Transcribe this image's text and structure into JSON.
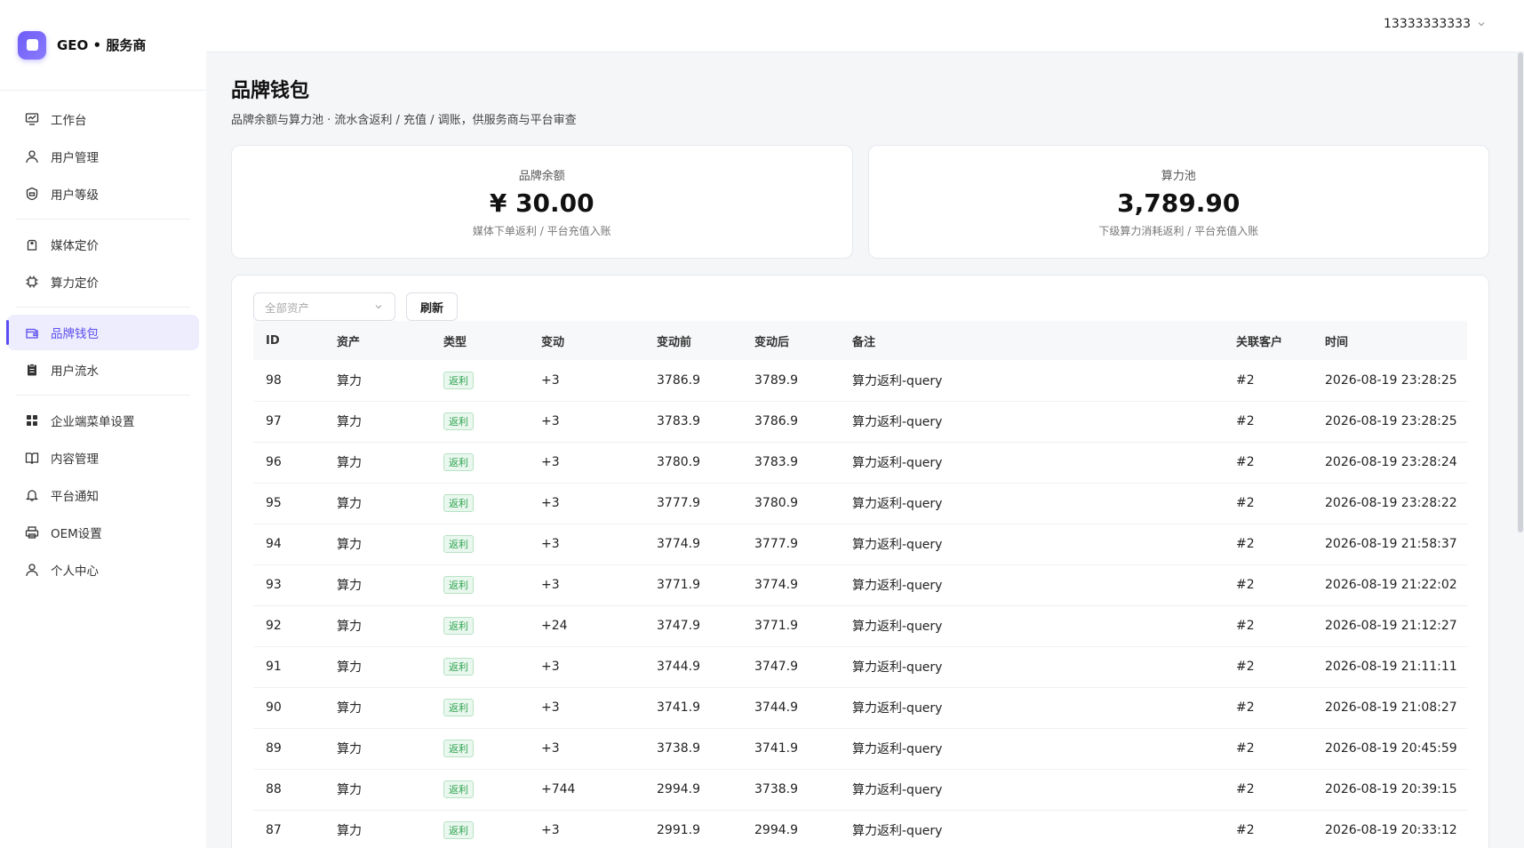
{
  "sidebar": {
    "brand": "GEO • 服务商",
    "items": [
      {
        "label": "工作台",
        "icon": "dashboard-icon"
      },
      {
        "label": "用户管理",
        "icon": "user-icon"
      },
      {
        "label": "用户等级",
        "icon": "badge-icon"
      },
      {
        "label": "媒体定价",
        "icon": "price-tag-icon"
      },
      {
        "label": "算力定价",
        "icon": "chip-icon"
      },
      {
        "label": "品牌钱包",
        "icon": "wallet-icon"
      },
      {
        "label": "用户流水",
        "icon": "clipboard-icon"
      },
      {
        "label": "企业端菜单设置",
        "icon": "grid-icon"
      },
      {
        "label": "内容管理",
        "icon": "book-icon"
      },
      {
        "label": "平台通知",
        "icon": "bell-icon"
      },
      {
        "label": "OEM设置",
        "icon": "printer-icon"
      },
      {
        "label": "个人中心",
        "icon": "person-icon"
      }
    ],
    "active": "品牌钱包"
  },
  "header": {
    "user": "13333333333"
  },
  "main": {
    "title": "品牌钱包",
    "subtitle": "品牌余额与算力池 · 流水含返利 / 充值 / 调账，供服务商与平台审查",
    "cards": [
      {
        "label": "品牌余额",
        "value": "¥ 30.00",
        "note": "媒体下单返利 / 平台充值入账"
      },
      {
        "label": "算力池",
        "value": "3,789.90",
        "note": "下级算力消耗返利 / 平台充值入账"
      }
    ],
    "filter": {
      "placeholder": "全部资产",
      "refresh": "刷新"
    },
    "table": {
      "columns": [
        "ID",
        "资产",
        "类型",
        "变动",
        "变动前",
        "变动后",
        "备注",
        "关联客户",
        "时间"
      ],
      "rows": [
        [
          "98",
          "算力",
          "返利",
          "+3",
          "3786.9",
          "3789.9",
          "算力返利-query",
          "#2",
          "2026-08-19 23:28:25"
        ],
        [
          "97",
          "算力",
          "返利",
          "+3",
          "3783.9",
          "3786.9",
          "算力返利-query",
          "#2",
          "2026-08-19 23:28:25"
        ],
        [
          "96",
          "算力",
          "返利",
          "+3",
          "3780.9",
          "3783.9",
          "算力返利-query",
          "#2",
          "2026-08-19 23:28:24"
        ],
        [
          "95",
          "算力",
          "返利",
          "+3",
          "3777.9",
          "3780.9",
          "算力返利-query",
          "#2",
          "2026-08-19 23:28:22"
        ],
        [
          "94",
          "算力",
          "返利",
          "+3",
          "3774.9",
          "3777.9",
          "算力返利-query",
          "#2",
          "2026-08-19 21:58:37"
        ],
        [
          "93",
          "算力",
          "返利",
          "+3",
          "3771.9",
          "3774.9",
          "算力返利-query",
          "#2",
          "2026-08-19 21:22:02"
        ],
        [
          "92",
          "算力",
          "返利",
          "+24",
          "3747.9",
          "3771.9",
          "算力返利-query",
          "#2",
          "2026-08-19 21:12:27"
        ],
        [
          "91",
          "算力",
          "返利",
          "+3",
          "3744.9",
          "3747.9",
          "算力返利-query",
          "#2",
          "2026-08-19 21:11:11"
        ],
        [
          "90",
          "算力",
          "返利",
          "+3",
          "3741.9",
          "3744.9",
          "算力返利-query",
          "#2",
          "2026-08-19 21:08:27"
        ],
        [
          "89",
          "算力",
          "返利",
          "+3",
          "3738.9",
          "3741.9",
          "算力返利-query",
          "#2",
          "2026-08-19 20:45:59"
        ],
        [
          "88",
          "算力",
          "返利",
          "+744",
          "2994.9",
          "3738.9",
          "算力返利-query",
          "#2",
          "2026-08-19 20:39:15"
        ],
        [
          "87",
          "算力",
          "返利",
          "+3",
          "2991.9",
          "2994.9",
          "算力返利-query",
          "#2",
          "2026-08-19 20:33:12"
        ]
      ]
    }
  },
  "colors": {
    "accent": "#5b4ef0",
    "tag_green": "#2ea44f"
  }
}
